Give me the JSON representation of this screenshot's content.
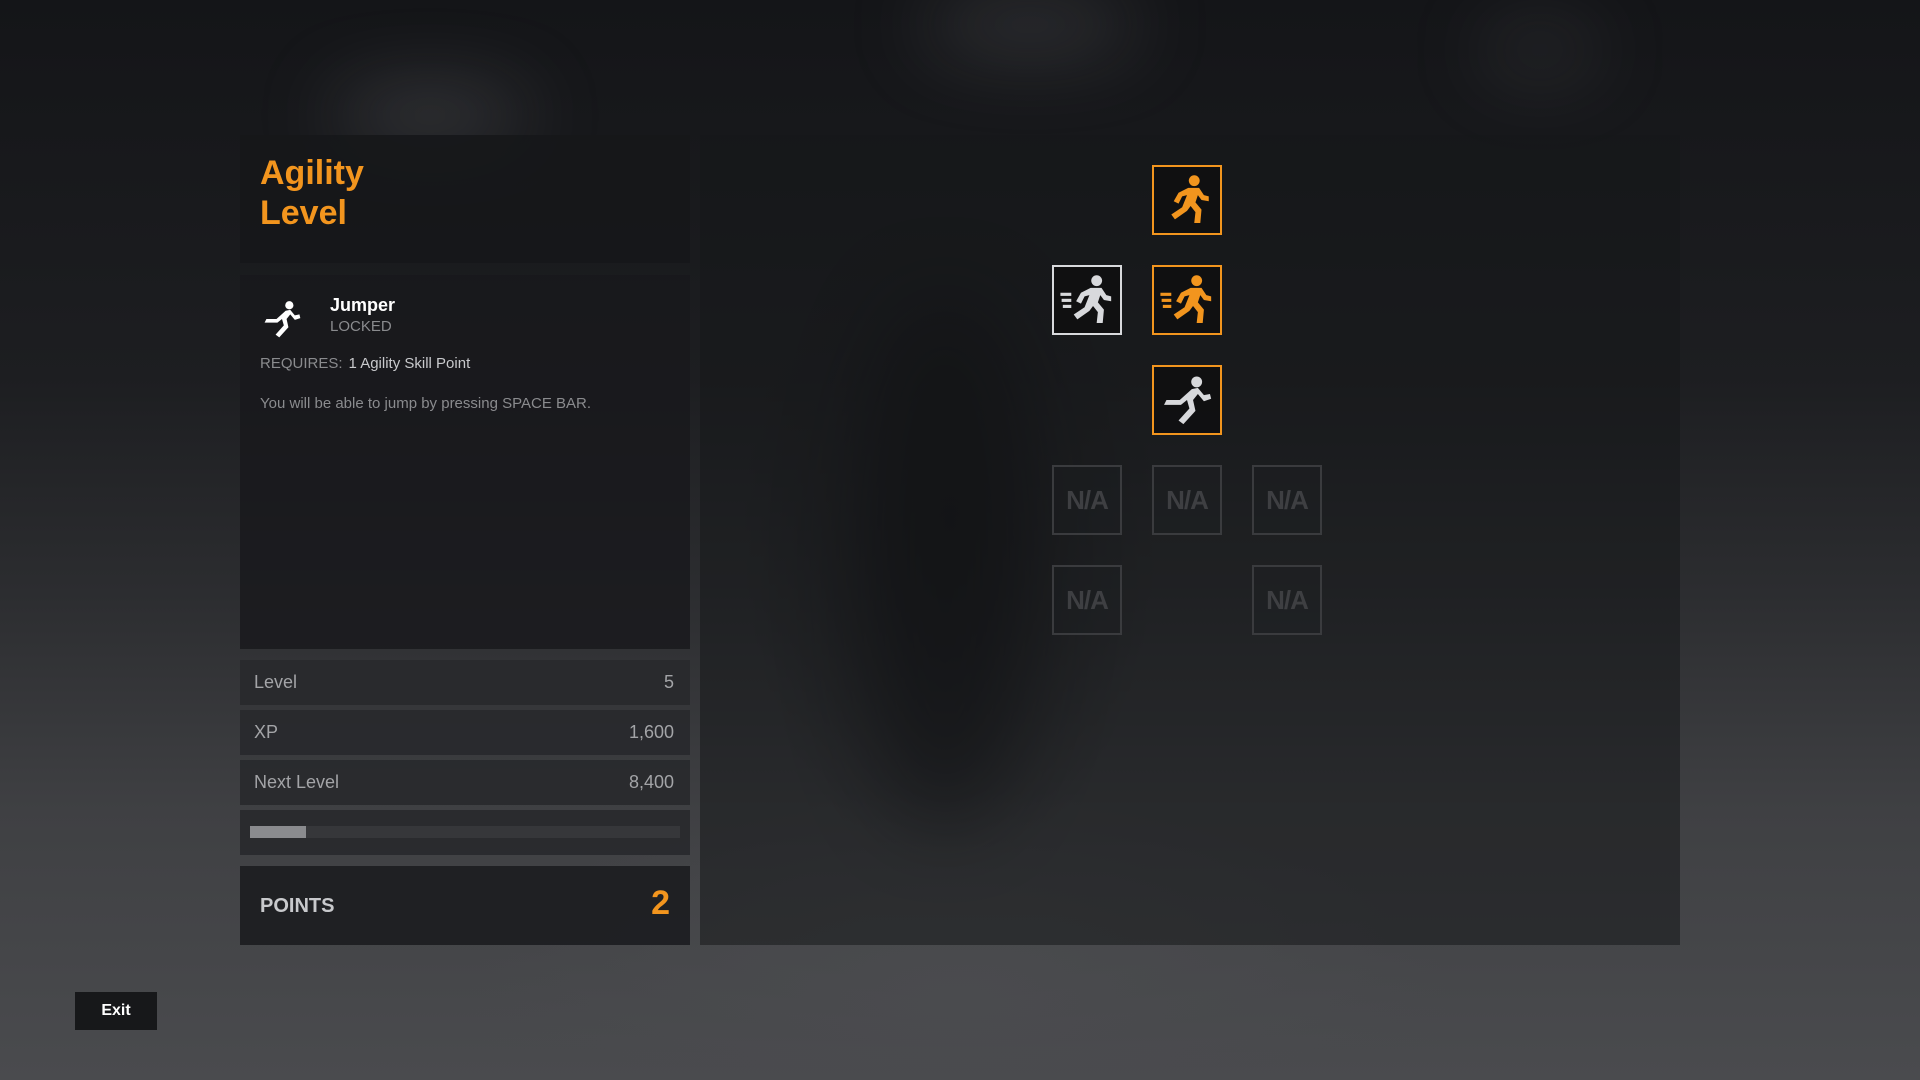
{
  "header": {
    "line1": "Agility",
    "line2": "Level"
  },
  "skill": {
    "name": "Jumper",
    "status": "LOCKED",
    "requires_label": "REQUIRES:",
    "requires_value": "1 Agility Skill Point",
    "description": "You will be able to jump by pressing SPACE BAR.",
    "icon": "jump-runner-icon"
  },
  "stats": [
    {
      "label": "Level",
      "value": "5"
    },
    {
      "label": "XP",
      "value": "1,600"
    },
    {
      "label": "Next Level",
      "value": "8,400"
    }
  ],
  "progress": {
    "fraction": 0.13
  },
  "points": {
    "label": "POINTS",
    "value": "2"
  },
  "tree": {
    "nodes": [
      {
        "icon": "runner-icon",
        "state": "orange"
      },
      {
        "icon": "sprinter-icon",
        "state": "white"
      },
      {
        "icon": "sprinter-icon",
        "state": "orange"
      },
      {
        "icon": "jump-runner-icon",
        "state": "orange-frame"
      },
      {
        "label": "N/A"
      },
      {
        "label": "N/A"
      },
      {
        "label": "N/A"
      },
      {
        "label": "N/A"
      },
      {
        "label": "N/A"
      }
    ]
  },
  "exit_button": {
    "label": "Exit"
  },
  "colors": {
    "accent": "#f2951e",
    "panel": "#16171a",
    "muted": "#8a8b8e"
  }
}
